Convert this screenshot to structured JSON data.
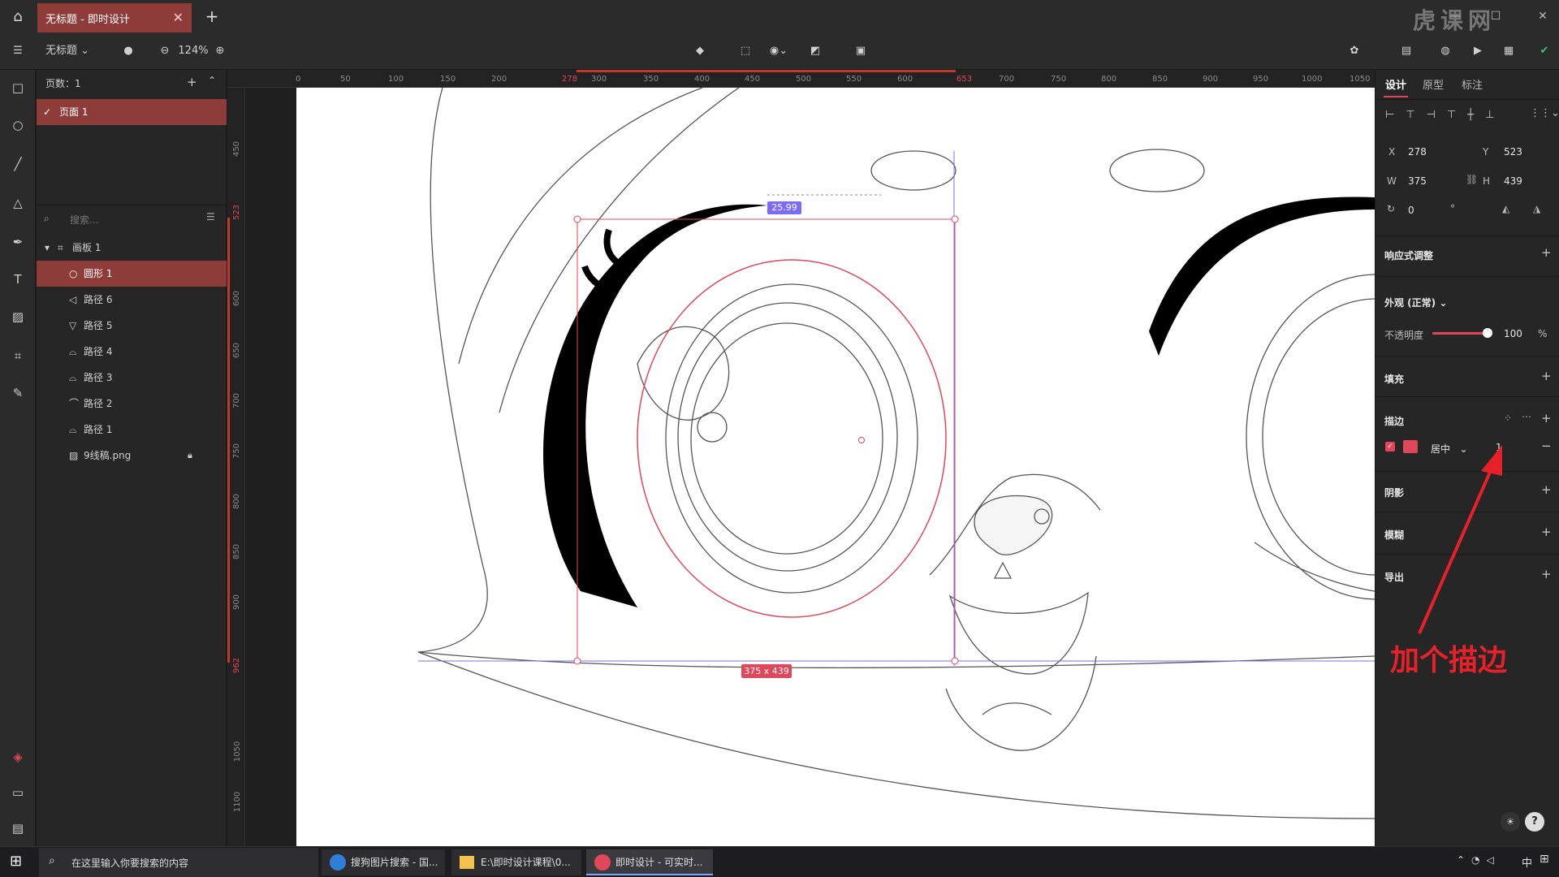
{
  "title_bar": {
    "doc_tab": "无标题 - 即时设计"
  },
  "toolbar": {
    "file_name": "无标题",
    "zoom": "124%"
  },
  "layers_panel": {
    "pages_header": "页数：1",
    "pages": [
      "页面 1"
    ],
    "search_placeholder": "搜索...",
    "items": [
      {
        "label": "画板 1"
      },
      {
        "label": "圆形 1"
      },
      {
        "label": "路径 6"
      },
      {
        "label": "路径 5"
      },
      {
        "label": "路径 4"
      },
      {
        "label": "路径 3"
      },
      {
        "label": "路径 2"
      },
      {
        "label": "路径 1"
      },
      {
        "label": "9线稿.png"
      }
    ]
  },
  "rulers": {
    "top": [
      "0",
      "50",
      "100",
      "150",
      "200",
      "278",
      "300",
      "350",
      "400",
      "450",
      "500",
      "550",
      "600",
      "653",
      "700",
      "750",
      "800",
      "850",
      "900",
      "950",
      "1000",
      "1050"
    ],
    "left": [
      "450",
      "523",
      "600",
      "650",
      "700",
      "750",
      "800",
      "850",
      "900",
      "962",
      "1050",
      "1100"
    ]
  },
  "canvas": {
    "radius_badge": "25.99",
    "size_badge": "375 x 439"
  },
  "props": {
    "tabs": [
      "设计",
      "原型",
      "标注"
    ],
    "x_label": "X",
    "x": "278",
    "y_label": "Y",
    "y": "523",
    "w_label": "W",
    "w": "375",
    "h_label": "H",
    "h": "439",
    "rotation": "0",
    "rotation_unit": "°",
    "responsive": "响应式调整",
    "appearance": "外观 (正常)",
    "opacity_label": "不透明度",
    "opacity": "100",
    "opacity_unit": "%",
    "fill": "填充",
    "stroke": "描边",
    "stroke_align": "居中",
    "stroke_width": "1",
    "shadow": "阴影",
    "blur": "模糊",
    "export": "导出"
  },
  "annotation": "加个描边",
  "watermark": "虎课网",
  "taskbar": {
    "search_placeholder": "在这里输入你要搜索的内容",
    "apps": [
      "搜狗图片搜索 - 国...",
      "E:\\即时设计课程\\0...",
      "即时设计 - 可实时..."
    ],
    "ime": "中"
  },
  "colors": {
    "accent": "#8e3c3a",
    "annotation": "#e8202a",
    "stroke_swatch": "#e0475a"
  }
}
